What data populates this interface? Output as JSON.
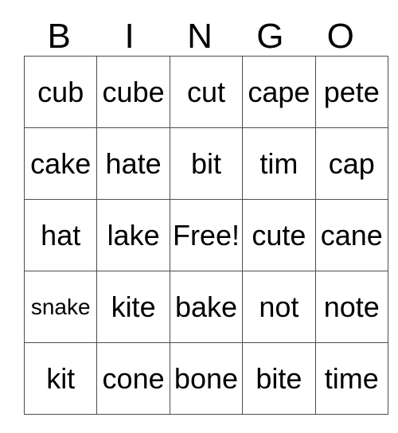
{
  "card": {
    "title": "BINGO",
    "headers": [
      "B",
      "I",
      "N",
      "G",
      "O"
    ],
    "free_space_label": "Free!",
    "free_space_position": {
      "row": 2,
      "col": 2
    },
    "rows": [
      {
        "cells": [
          {
            "text": "cub",
            "small": false
          },
          {
            "text": "cube",
            "small": false
          },
          {
            "text": "cut",
            "small": false
          },
          {
            "text": "cape",
            "small": false
          },
          {
            "text": "pete",
            "small": false
          }
        ]
      },
      {
        "cells": [
          {
            "text": "cake",
            "small": false
          },
          {
            "text": "hate",
            "small": false
          },
          {
            "text": "bit",
            "small": false
          },
          {
            "text": "tim",
            "small": false
          },
          {
            "text": "cap",
            "small": false
          }
        ]
      },
      {
        "cells": [
          {
            "text": "hat",
            "small": false
          },
          {
            "text": "lake",
            "small": false
          },
          {
            "text": "Free!",
            "small": false
          },
          {
            "text": "cute",
            "small": false
          },
          {
            "text": "cane",
            "small": false
          }
        ]
      },
      {
        "cells": [
          {
            "text": "snake",
            "small": true
          },
          {
            "text": "kite",
            "small": false
          },
          {
            "text": "bake",
            "small": false
          },
          {
            "text": "not",
            "small": false
          },
          {
            "text": "note",
            "small": false
          }
        ]
      },
      {
        "cells": [
          {
            "text": "kit",
            "small": false
          },
          {
            "text": "cone",
            "small": false
          },
          {
            "text": "bone",
            "small": false
          },
          {
            "text": "bite",
            "small": false
          },
          {
            "text": "time",
            "small": false
          }
        ]
      }
    ]
  },
  "colors": {
    "background": "#ffffff",
    "text": "#000000",
    "grid_line": "#4d4d4d"
  }
}
